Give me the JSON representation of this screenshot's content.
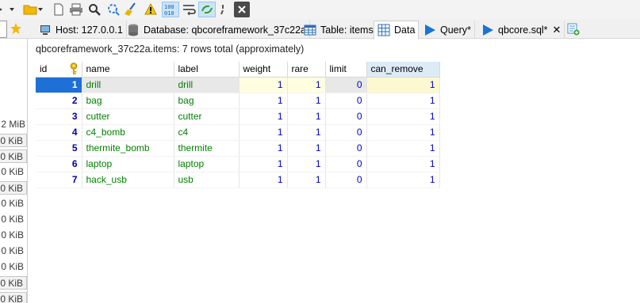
{
  "tabs": [
    {
      "label": "Host: 127.0.0.1",
      "icon": "host-icon"
    },
    {
      "label": "Database: qbcoreframework_37c22a",
      "icon": "database-icon"
    },
    {
      "label": "Table: items",
      "icon": "table-icon"
    },
    {
      "label": "Data",
      "icon": "data-grid-icon",
      "active": true
    },
    {
      "label": "Query*",
      "icon": "play-icon"
    },
    {
      "label": "qbcore.sql*",
      "icon": "play-icon",
      "closable": true
    }
  ],
  "left_pane": {
    "sizes": [
      "2 MiB",
      "0 KiB",
      "0 KiB",
      "0 KiB",
      "0 KiB",
      "0 KiB",
      "0 KiB",
      "0 KiB",
      "0 KiB",
      "0 KiB",
      "0 KiB",
      "0 KiB"
    ]
  },
  "info_text": "qbcoreframework_37c22a.items: 7 rows total (approximately)",
  "table": {
    "columns": [
      "id",
      "name",
      "label",
      "weight",
      "rare",
      "limit",
      "can_remove"
    ],
    "rows": [
      [
        "1",
        "drill",
        "drill",
        "1",
        "1",
        "0",
        "1"
      ],
      [
        "2",
        "bag",
        "bag",
        "1",
        "1",
        "0",
        "1"
      ],
      [
        "3",
        "cutter",
        "cutter",
        "1",
        "1",
        "0",
        "1"
      ],
      [
        "4",
        "c4_bomb",
        "c4",
        "1",
        "1",
        "0",
        "1"
      ],
      [
        "5",
        "thermite_bomb",
        "thermite",
        "1",
        "1",
        "0",
        "1"
      ],
      [
        "6",
        "laptop",
        "laptop",
        "1",
        "1",
        "0",
        "1"
      ],
      [
        "7",
        "hack_usb",
        "usb",
        "1",
        "1",
        "0",
        "1"
      ]
    ]
  },
  "colors": {
    "selection": "#1e6fd6",
    "text_green": "#008000",
    "number_blue": "#0000cc",
    "header_selected": "#ddebf7"
  }
}
